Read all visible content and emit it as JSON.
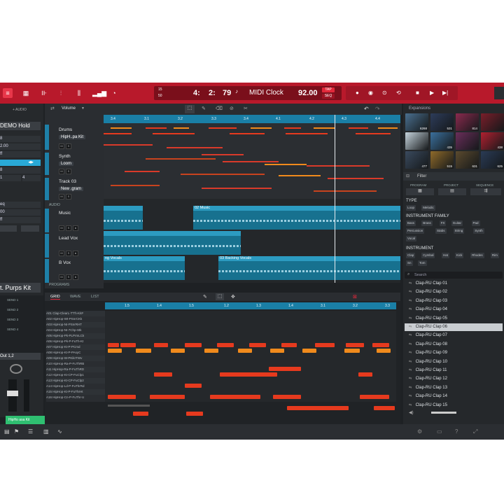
{
  "transport": {
    "bar": "4:",
    "beat": "2:",
    "tick": "79",
    "pre_label_top": "15",
    "pre_label_bottom": "50",
    "clock": "MIDI Clock",
    "tempo": "92.00",
    "tap": "TAP",
    "mode": "SEQ"
  },
  "left_panel": {
    "header": "+ AUDIO",
    "program": "DEMO Hold",
    "row1": "8",
    "row2": "2.00",
    "row3": "ff",
    "row4": "8",
    "row5_a": "1",
    "row5_b": "4",
    "eq": "eq",
    "val1": "00",
    "val2": "ff",
    "program2": "t. Purps Kit",
    "pads": [
      "SEND 1",
      "SEND 2",
      "SEND 3",
      "SEND 4"
    ],
    "output": "Out 1,2",
    "kit": "HipHo asa Kit"
  },
  "arrange": {
    "automation": "Volume",
    "ruler": [
      "3.4",
      "3.1",
      "3.2",
      "3.3",
      "3.4",
      "4.1",
      "4.2",
      "4.3",
      "4.4"
    ],
    "tracks": [
      {
        "name": "Drums",
        "sub": "HipH..pa Kit"
      },
      {
        "name": "Synth",
        "sub": "Loom"
      },
      {
        "name": "Track 03",
        "sub": "New .gram"
      }
    ],
    "audio_label": "AUDIO",
    "audio_tracks": [
      {
        "name": "Music",
        "clip": "02 Music"
      },
      {
        "name": "Lead Vox",
        "clip": ""
      },
      {
        "name": "B Vox",
        "clip_a": "ng Vocals",
        "clip_b": "03 Backing Vocals"
      }
    ],
    "programs_label": "PROGRAMS"
  },
  "piano_roll": {
    "tabs": [
      "GRID",
      "WAVE",
      "LIST"
    ],
    "ruler": [
      "1.5",
      "1.4",
      "1.5",
      "1.2",
      "1.3",
      "1.4",
      "3.1",
      "3.2",
      "3.3"
    ],
    "pads": [
      "A01 Clap-ClearL-T'Th-Kit#",
      "A02 HipHop-Wt-PSnrCKk",
      "A03 HipHop-NI-PSnrRHT",
      "A04 HipHop-NI-7Chp-Stk",
      "A05 HipHop-Pk-PLPrmLCk",
      "A06 HipHop-Pk-P-FuTh-Kt",
      "A07 HipHop-Kt-P-PCmd",
      "A08 HipHop-Kt-P-PAsyC",
      "A09 HipHop-W-PKikrTWv",
      "A10 HipHop-Ra-P-FuThRB",
      "A11 HipHop-Ra-P-FuThRD",
      "A12 HipHop-Kt-CP-FuClp1",
      "A13 HipHop-Kt-CP-FuClp2",
      "A14 HipHop-Ld-P-FuThrRd",
      "A15 HipHop-Kt-P-FuThrHt",
      "A16 HipHop-Cn-P-FuThr-U"
    ]
  },
  "right_panel": {
    "expansions_title": "Expansions",
    "expansion_numbers": [
      "6268",
      "531",
      "814",
      "",
      "",
      "435",
      "",
      "438",
      "477",
      "515",
      "631",
      "625"
    ],
    "filter_title": "Filter",
    "filter_tabs": [
      "PROGRAM",
      "PROJECT",
      "SEQUENCE"
    ],
    "type_label": "TYPE",
    "type_tags": [
      "Loop",
      "Melodic"
    ],
    "family_label": "INSTRUMENT FAMILY",
    "family_tags": [
      "Bass",
      "Brass",
      "FX",
      "Guitar",
      "Pad",
      "Percussion",
      "Stabs",
      "String",
      "Synth",
      "Vocal"
    ],
    "instrument_label": "INSTRUMENT",
    "instrument_tags": [
      "Clap",
      "Cymbal",
      "Hat",
      "Kick",
      "Rhodes",
      "Rim",
      "Sn",
      "Tom"
    ],
    "search_placeholder": "Search",
    "library": [
      "Clap-RU Clap 01",
      "Clap-RU Clap 02",
      "Clap-RU Clap 03",
      "Clap-RU Clap 04",
      "Clap-RU Clap 05",
      "Clap-RU Clap 06",
      "Clap-RU Clap 07",
      "Clap-RU Clap 08",
      "Clap-RU Clap 09",
      "Clap-RU Clap 10",
      "Clap-RU Clap 11",
      "Clap-RU Clap 12",
      "Clap-RU Clap 13",
      "Clap-RU Clap 14",
      "Clap-RU Clap 15"
    ],
    "selected_index": 5
  },
  "colors": {
    "brand_red": "#b8192b",
    "accent_blue": "#29a9d6",
    "note_red": "#e63a1e",
    "note_orange": "#f08a1c"
  }
}
